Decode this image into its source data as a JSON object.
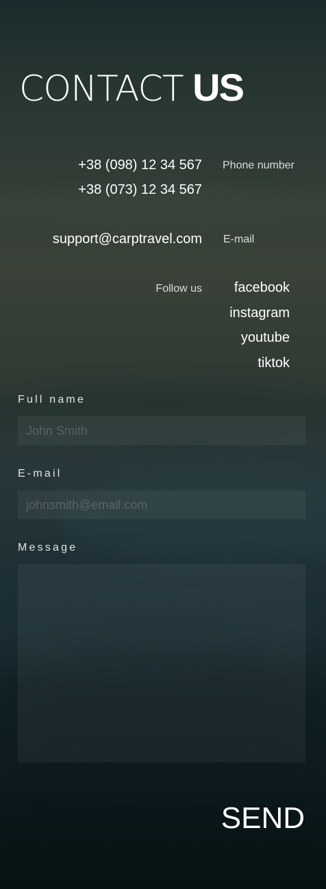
{
  "header": {
    "title_light": "CONTACT",
    "title_bold": "US"
  },
  "contacts": {
    "phones": [
      "+38 (098) 12 34 567",
      "+38 (073) 12 34 567"
    ],
    "phone_label": "Phone number",
    "email": "support@carptravel.com",
    "email_label": "E-mail",
    "follow_label": "Follow us",
    "socials": [
      "facebook",
      "instagram",
      "youtube",
      "tiktok"
    ]
  },
  "form": {
    "name_label": "Full name",
    "name_placeholder": "John Smith",
    "email_label": "E-mail",
    "email_placeholder": "johnsmith@email.com",
    "message_label": "Message",
    "send_label": "SEND"
  }
}
